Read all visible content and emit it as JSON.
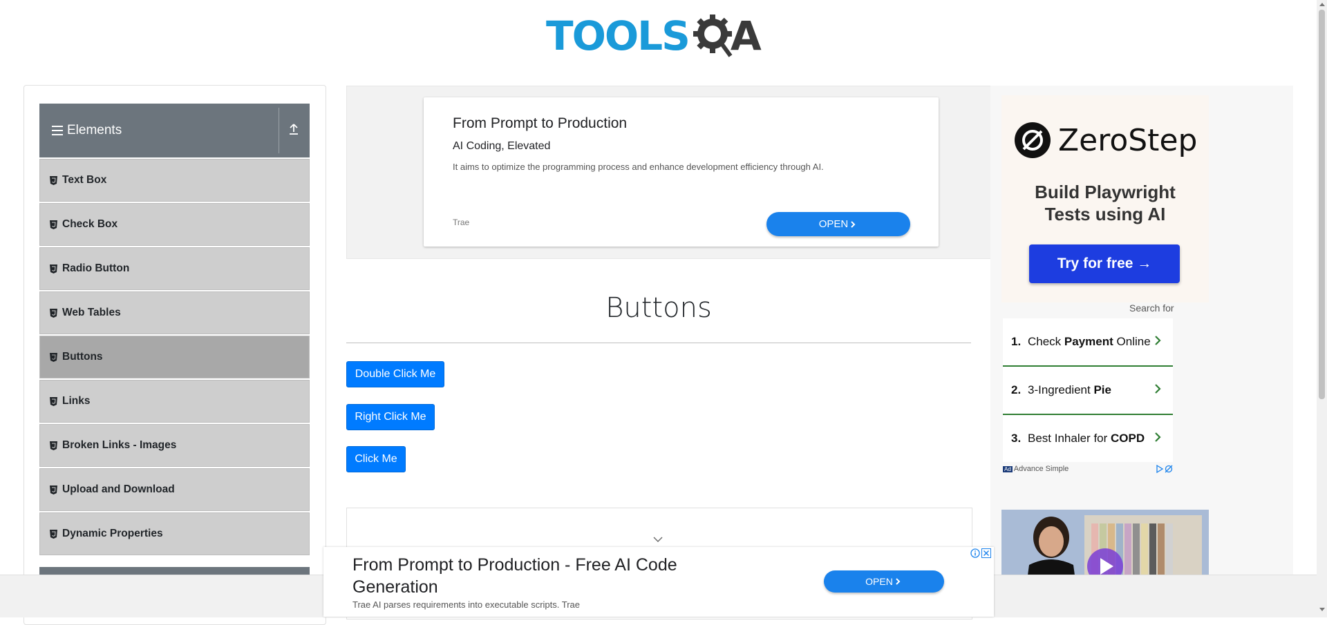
{
  "header": {
    "logo_text": "TOOLS",
    "logo_suffix": "A"
  },
  "sidebar": {
    "group_title": "Elements",
    "items": [
      {
        "label": "Text Box"
      },
      {
        "label": "Check Box"
      },
      {
        "label": "Radio Button"
      },
      {
        "label": "Web Tables"
      },
      {
        "label": "Buttons",
        "active": true
      },
      {
        "label": "Links"
      },
      {
        "label": "Broken Links - Images"
      },
      {
        "label": "Upload and Download"
      },
      {
        "label": "Dynamic Properties"
      }
    ]
  },
  "top_ad": {
    "headline": "From Prompt to Production",
    "subhead": "AI Coding, Elevated",
    "description": "It aims to optimize the programming process and enhance development efficiency through AI.",
    "brand": "Trae",
    "cta": "OPEN"
  },
  "main": {
    "title": "Buttons",
    "buttons": {
      "double_click": "Double Click Me",
      "right_click": "Right Click Me",
      "click": "Click Me"
    }
  },
  "right_ad": {
    "brand": "ZeroStep",
    "tagline_line1": "Build Playwright",
    "tagline_line2": "Tests using AI",
    "cta": "Try for free →",
    "search_for": "Search for",
    "results": [
      {
        "num": "1.",
        "pre": "Check ",
        "bold": "Payment",
        "post": " Online"
      },
      {
        "num": "2.",
        "pre": "3-Ingredient ",
        "bold": "Pie",
        "post": ""
      },
      {
        "num": "3.",
        "pre": "Best Inhaler for ",
        "bold": "COPD",
        "post": ""
      }
    ],
    "footer_badge": "Ad",
    "footer_text": "Advance Simple"
  },
  "bottom_ad": {
    "headline": "From Prompt to Production - Free AI Code Generation",
    "description": "Trae AI parses requirements into executable scripts. Trae",
    "cta": "OPEN"
  },
  "colors": {
    "primary_button": "#007bff",
    "sidebar_header": "#6c757d",
    "logo_blue": "#1a9ad9",
    "ad_cta": "#1a82ec",
    "zerostep_cta": "#1d3de0"
  }
}
